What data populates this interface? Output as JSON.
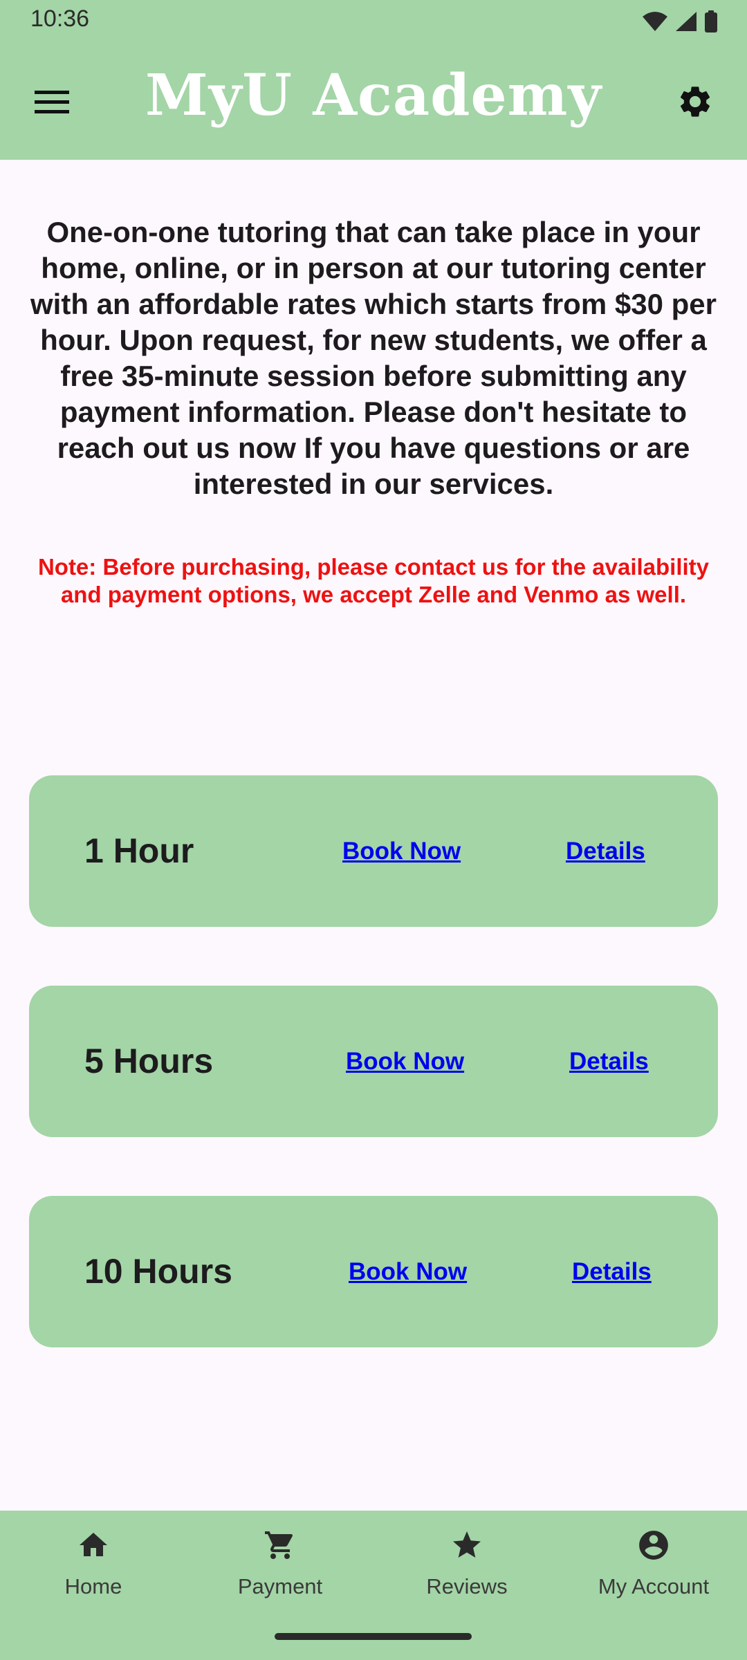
{
  "status_bar": {
    "time": "10:36",
    "icons": [
      "wifi-icon",
      "cellular-signal-icon",
      "battery-icon"
    ]
  },
  "app_bar": {
    "title": "MyU Academy",
    "menu_icon": "hamburger-menu-icon",
    "settings_icon": "gear-icon"
  },
  "content": {
    "intro": "One-on-one tutoring that can take place in your home, online, or in person at our tutoring center with an affordable rates which starts from $30 per hour. Upon request, for new students, we offer a free 35-minute session before submitting any payment information. Please don't hesitate to reach out us now If you have questions or are interested in our services.",
    "note": "Note: Before purchasing, please contact us for the availability and payment options, we accept Zelle and Venmo as well."
  },
  "packages": [
    {
      "name": "1 Hour",
      "book_label": "Book Now",
      "details_label": "Details"
    },
    {
      "name": "5 Hours",
      "book_label": "Book Now",
      "details_label": "Details"
    },
    {
      "name": "10 Hours",
      "book_label": "Book Now",
      "details_label": "Details"
    }
  ],
  "bottom_nav": {
    "items": [
      {
        "label": "Home",
        "icon": "home-icon"
      },
      {
        "label": "Payment",
        "icon": "shopping-cart-icon"
      },
      {
        "label": "Reviews",
        "icon": "star-icon"
      },
      {
        "label": "My Account",
        "icon": "account-circle-icon"
      }
    ]
  },
  "colors": {
    "accent_green": "#a3d5a6",
    "note_red": "#ee1111",
    "link_blue": "#0000ee",
    "background": "#fdf8fd"
  }
}
